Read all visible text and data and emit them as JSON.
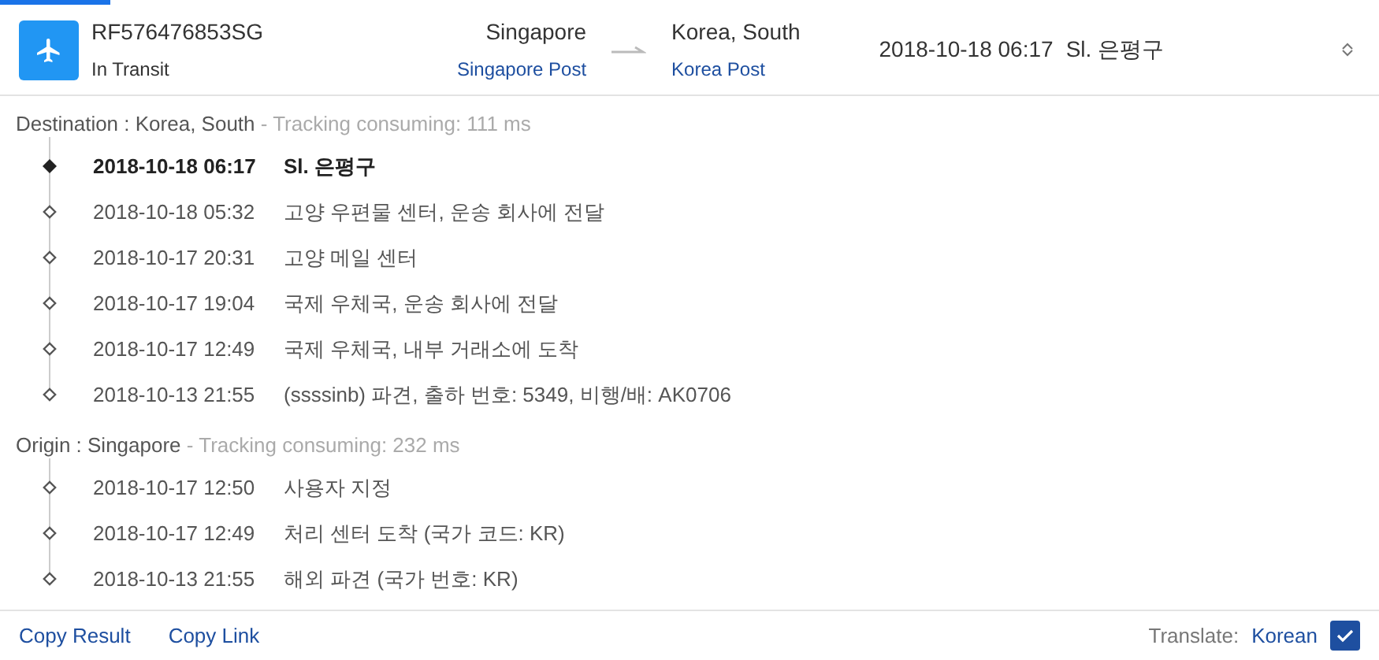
{
  "shipment": {
    "tracking_number": "RF576476853SG",
    "status": "In Transit",
    "origin": {
      "country": "Singapore",
      "carrier": "Singapore Post"
    },
    "destination": {
      "country": "Korea, South",
      "carrier": "Korea Post"
    },
    "latest_time": "2018-10-18 06:17",
    "latest_place": "Sl. 은평구",
    "expanded": true
  },
  "sections": [
    {
      "label": "Destination : Korea, South",
      "timing": "- Tracking consuming: 111 ms",
      "events": [
        {
          "time": "2018-10-18 06:17",
          "text": "Sl. 은평구",
          "current": true
        },
        {
          "time": "2018-10-18 05:32",
          "text": "고양 우편물 센터, 운송 회사에 전달",
          "current": false
        },
        {
          "time": "2018-10-17 20:31",
          "text": "고양 메일 센터",
          "current": false
        },
        {
          "time": "2018-10-17 19:04",
          "text": "국제 우체국, 운송 회사에 전달",
          "current": false
        },
        {
          "time": "2018-10-17 12:49",
          "text": "국제 우체국, 내부 거래소에 도착",
          "current": false
        },
        {
          "time": "2018-10-13 21:55",
          "text": "(ssssinb) 파견, 출하 번호: 5349, 비행/배: AK0706",
          "current": false
        }
      ]
    },
    {
      "label": "Origin : Singapore",
      "timing": "- Tracking consuming: 232 ms",
      "events": [
        {
          "time": "2018-10-17 12:50",
          "text": "사용자 지정",
          "current": false
        },
        {
          "time": "2018-10-17 12:49",
          "text": "처리 센터 도착 (국가 코드: KR)",
          "current": false
        },
        {
          "time": "2018-10-13 21:55",
          "text": "해외 파견 (국가 번호: KR)",
          "current": false
        }
      ]
    }
  ],
  "footer": {
    "links": [
      "Copy Result",
      "Copy Link"
    ],
    "translate_label": "Translate:",
    "language": "Korean",
    "translate_checked": true
  }
}
